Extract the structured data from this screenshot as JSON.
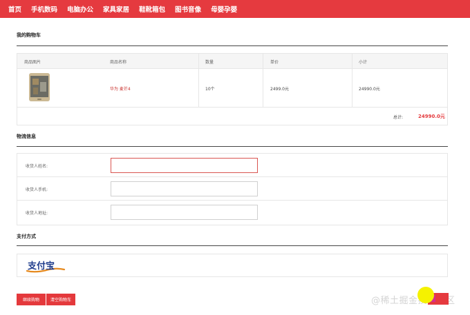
{
  "nav": {
    "items": [
      "首页",
      "手机数码",
      "电脑办公",
      "家具家居",
      "鞋靴箱包",
      "图书音像",
      "母婴孕婴"
    ]
  },
  "cart": {
    "title": "我的购物车",
    "headers": [
      "商品图片",
      "商品名称",
      "数量",
      "单价",
      "小计"
    ],
    "row": {
      "image": "phone-product-image",
      "name": "华为 麦芒4",
      "quantity": "10个",
      "price": "2499.0元",
      "subtotal": "24990.0元"
    },
    "total_label": "总计:",
    "total_value": "24990.0元"
  },
  "shipping": {
    "title": "物流信息",
    "fields": [
      {
        "label": "收货人姓名:",
        "value": ""
      },
      {
        "label": "收货人手机:",
        "value": ""
      },
      {
        "label": "收货人地址:",
        "value": ""
      }
    ]
  },
  "payment": {
    "title": "支付方式",
    "logo_text": "支付宝",
    "logo_icon": "alipay-logo"
  },
  "buttons": {
    "checkout": "继续购物",
    "clear": "清空购物车"
  },
  "watermark": "@稀土掘金技术社区",
  "colors": {
    "brand_red": "#e53a3f",
    "price_red": "#e4393c",
    "link_red": "#c9302c",
    "cursor_yellow": "#f5f200"
  }
}
